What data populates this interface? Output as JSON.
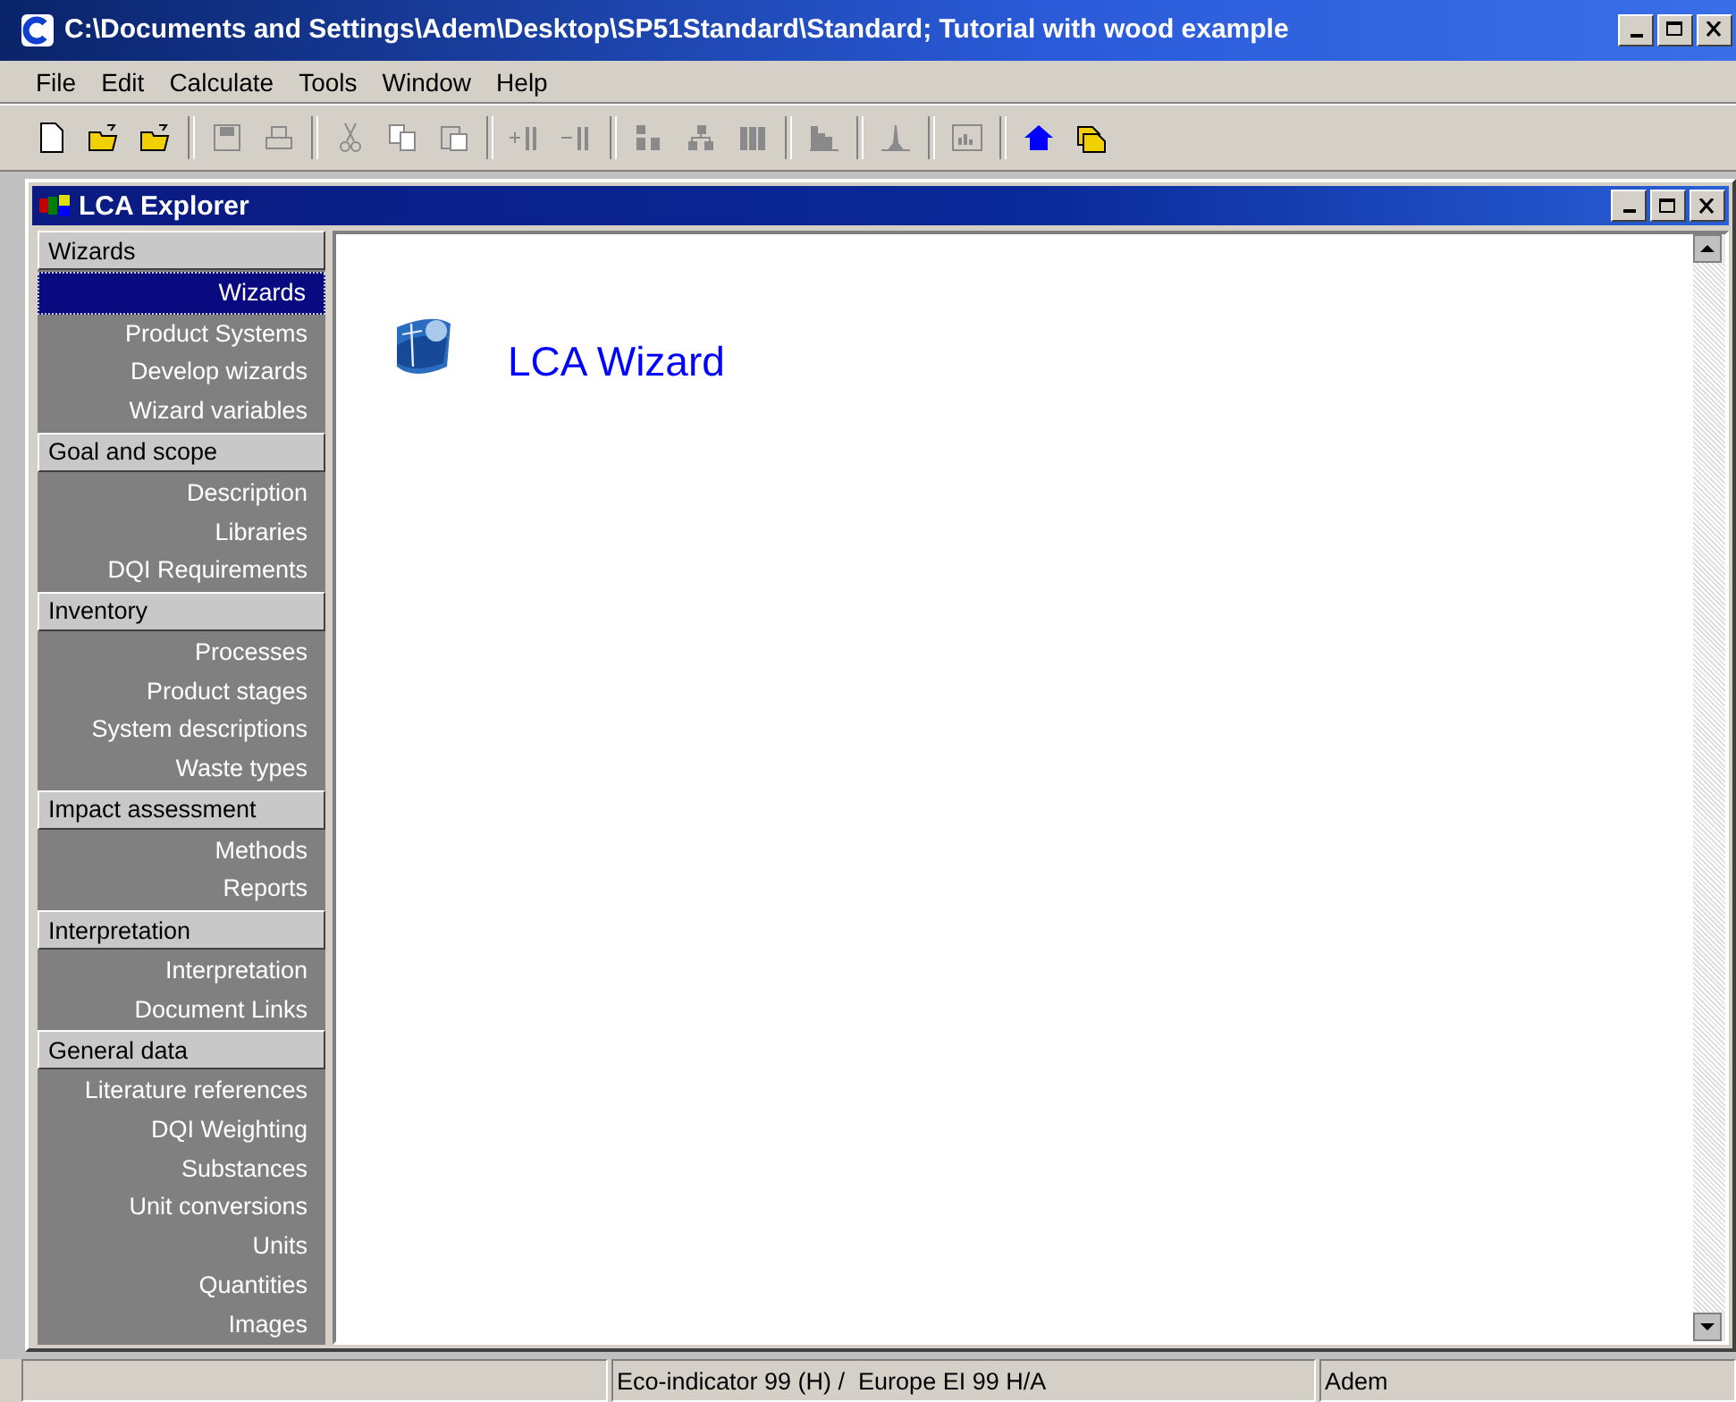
{
  "window": {
    "title": "C:\\Documents and Settings\\Adem\\Desktop\\SP51Standard\\Standard; Tutorial with wood example"
  },
  "menu": [
    "File",
    "Edit",
    "Calculate",
    "Tools",
    "Window",
    "Help"
  ],
  "toolbar": [
    {
      "kind": "new",
      "disabled": false
    },
    {
      "kind": "open",
      "disabled": false
    },
    {
      "kind": "open",
      "disabled": false
    },
    {
      "kind": "sep"
    },
    {
      "kind": "save",
      "disabled": true
    },
    {
      "kind": "print",
      "disabled": true
    },
    {
      "kind": "sep"
    },
    {
      "kind": "cut",
      "disabled": true
    },
    {
      "kind": "copy",
      "disabled": true
    },
    {
      "kind": "paste",
      "disabled": true
    },
    {
      "kind": "sep"
    },
    {
      "kind": "addcol",
      "disabled": true
    },
    {
      "kind": "delcol",
      "disabled": true
    },
    {
      "kind": "sep"
    },
    {
      "kind": "network",
      "disabled": true
    },
    {
      "kind": "tree",
      "disabled": true
    },
    {
      "kind": "bars",
      "disabled": true
    },
    {
      "kind": "sep"
    },
    {
      "kind": "histogram",
      "disabled": true
    },
    {
      "kind": "sep"
    },
    {
      "kind": "peak",
      "disabled": true
    },
    {
      "kind": "sep"
    },
    {
      "kind": "chartframe",
      "disabled": true
    },
    {
      "kind": "sep"
    },
    {
      "kind": "home",
      "disabled": false
    },
    {
      "kind": "folders",
      "disabled": false
    }
  ],
  "child_window": {
    "title": "LCA Explorer"
  },
  "sidebar": [
    {
      "title": "Wizards",
      "items": [
        {
          "label": "Wizards",
          "selected": true
        },
        {
          "label": "Product Systems",
          "selected": false
        },
        {
          "label": "Develop wizards",
          "selected": false
        },
        {
          "label": "Wizard variables",
          "selected": false
        }
      ]
    },
    {
      "title": "Goal and scope",
      "items": [
        {
          "label": "Description",
          "selected": false
        },
        {
          "label": "Libraries",
          "selected": false
        },
        {
          "label": "DQI Requirements",
          "selected": false
        }
      ]
    },
    {
      "title": "Inventory",
      "items": [
        {
          "label": "Processes",
          "selected": false
        },
        {
          "label": "Product stages",
          "selected": false
        },
        {
          "label": "System descriptions",
          "selected": false
        },
        {
          "label": "Waste types",
          "selected": false
        }
      ]
    },
    {
      "title": "Impact assessment",
      "items": [
        {
          "label": "Methods",
          "selected": false
        },
        {
          "label": "Reports",
          "selected": false
        }
      ]
    },
    {
      "title": "Interpretation",
      "items": [
        {
          "label": "Interpretation",
          "selected": false
        },
        {
          "label": "Document Links",
          "selected": false
        }
      ]
    },
    {
      "title": "General data",
      "items": [
        {
          "label": "Literature references",
          "selected": false
        },
        {
          "label": "DQI Weighting",
          "selected": false
        },
        {
          "label": "Substances",
          "selected": false
        },
        {
          "label": "Unit conversions",
          "selected": false
        },
        {
          "label": "Units",
          "selected": false
        },
        {
          "label": "Quantities",
          "selected": false
        },
        {
          "label": "Images",
          "selected": false
        }
      ]
    }
  ],
  "content": {
    "link": "LCA Wizard"
  },
  "status_bar": [
    "Eco-indicator 99 (H) /  Europe EI 99 H/A",
    "Adem"
  ]
}
